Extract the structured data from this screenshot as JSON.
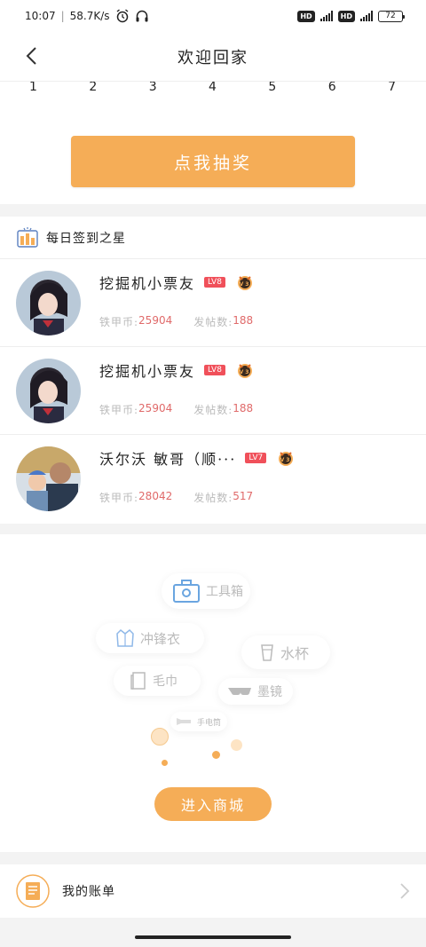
{
  "status_bar": {
    "time": "10:07",
    "net_speed": "58.7K/s",
    "alarm_icon": "alarm-icon",
    "headset_icon": "headset-icon",
    "hd1": "HD",
    "hd2": "HD",
    "battery": "72"
  },
  "header": {
    "title": "欢迎回家",
    "back_icon": "chevron-left-icon"
  },
  "calendar": {
    "days": [
      "1",
      "2",
      "3",
      "4",
      "5",
      "6",
      "7"
    ]
  },
  "lottery_button": "点我抽奖",
  "star_section": {
    "title": "每日签到之星",
    "users": [
      {
        "name": "挖掘机小票友",
        "level": "LV8",
        "coin_label": "铁甲币:",
        "coins": "25904",
        "posts_label": "发帖数:",
        "posts": "188",
        "medal": "V3"
      },
      {
        "name": "挖掘机小票友",
        "level": "LV8",
        "coin_label": "铁甲币:",
        "coins": "25904",
        "posts_label": "发帖数:",
        "posts": "188",
        "medal": "V3"
      },
      {
        "name": "沃尔沃  敏哥（顺···",
        "level": "LV7",
        "coin_label": "铁甲币:",
        "coins": "28042",
        "posts_label": "发帖数:",
        "posts": "517",
        "medal": "V3"
      }
    ]
  },
  "mall": {
    "items": [
      "工具箱",
      "冲锋衣",
      "水杯",
      "毛巾",
      "墨镜",
      "手电筒"
    ],
    "enter_button": "进入商城"
  },
  "bill": {
    "label": "我的账单"
  },
  "colors": {
    "accent": "#f5ad57",
    "level_badge": "#f0505a",
    "number_red": "#e06a6a"
  }
}
